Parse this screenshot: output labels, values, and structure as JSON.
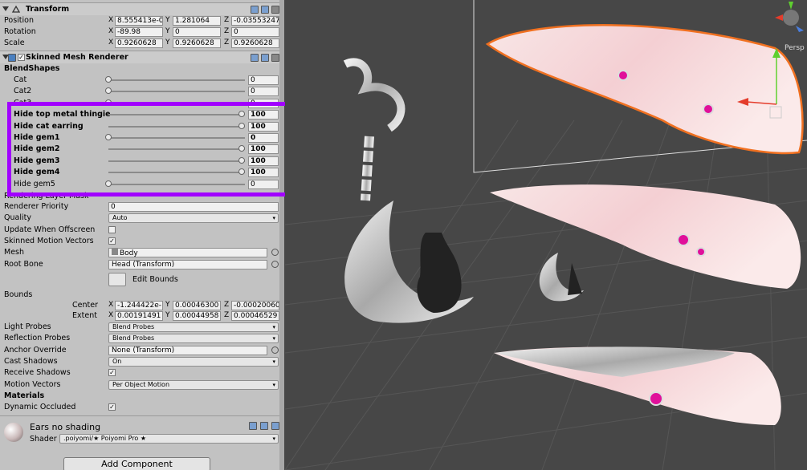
{
  "transform": {
    "title": "Transform",
    "position": {
      "label": "Position",
      "x": "8.555413e-0",
      "y": "1.281064",
      "z": "-0.03553247"
    },
    "rotation": {
      "label": "Rotation",
      "x": "-89.98",
      "y": "0",
      "z": "0"
    },
    "scale": {
      "label": "Scale",
      "x": "0.9260628",
      "y": "0.9260628",
      "z": "0.9260628"
    },
    "axis_x": "X",
    "axis_y": "Y",
    "axis_z": "Z"
  },
  "smr": {
    "title": "Skinned Mesh Renderer",
    "blendshapes_label": "BlendShapes",
    "blendshapes": [
      {
        "name": "Cat",
        "value": "0",
        "fraction": 0,
        "bold": false
      },
      {
        "name": "Cat2",
        "value": "0",
        "fraction": 0,
        "bold": false
      },
      {
        "name": "Cat3",
        "value": "0",
        "fraction": 0,
        "bold": false
      },
      {
        "name": "Hide top metal thingie",
        "value": "100",
        "fraction": 1,
        "bold": true
      },
      {
        "name": "Hide cat earring",
        "value": "100",
        "fraction": 1,
        "bold": true
      },
      {
        "name": "Hide gem1",
        "value": "0",
        "fraction": 0,
        "bold": true
      },
      {
        "name": "Hide gem2",
        "value": "100",
        "fraction": 1,
        "bold": true
      },
      {
        "name": "Hide gem3",
        "value": "100",
        "fraction": 1,
        "bold": true
      },
      {
        "name": "Hide gem4",
        "value": "100",
        "fraction": 1,
        "bold": true
      },
      {
        "name": "Hide gem5",
        "value": "0",
        "fraction": 0,
        "bold": false
      }
    ],
    "rendering_layer_mask_label": "Rendering Layer Mask",
    "renderer_priority": {
      "label": "Renderer Priority",
      "value": "0"
    },
    "quality": {
      "label": "Quality",
      "value": "Auto"
    },
    "update_offscreen": {
      "label": "Update When Offscreen",
      "checked": false
    },
    "skinned_motion": {
      "label": "Skinned Motion Vectors",
      "checked": true
    },
    "mesh": {
      "label": "Mesh",
      "value": "Body"
    },
    "root_bone": {
      "label": "Root Bone",
      "value": "Head (Transform)"
    },
    "edit_bounds": "Edit Bounds",
    "bounds_label": "Bounds",
    "center": {
      "label": "Center",
      "x": "-1.244422e-",
      "y": "0.00046300",
      "z": "-0.00020060"
    },
    "extent": {
      "label": "Extent",
      "x": "0.00191491",
      "y": "0.00044958",
      "z": "0.00046529"
    },
    "light_probes": {
      "label": "Light Probes",
      "value": "Blend Probes"
    },
    "reflection_probes": {
      "label": "Reflection Probes",
      "value": "Blend Probes"
    },
    "anchor_override": {
      "label": "Anchor Override",
      "value": "None (Transform)"
    },
    "cast_shadows": {
      "label": "Cast Shadows",
      "value": "On"
    },
    "receive_shadows": {
      "label": "Receive Shadows",
      "checked": true
    },
    "motion_vectors": {
      "label": "Motion Vectors",
      "value": "Per Object Motion"
    },
    "materials_label": "Materials",
    "dynamic_occluded": {
      "label": "Dynamic Occluded",
      "checked": true
    }
  },
  "material": {
    "name": "Ears no shading",
    "shader_label": "Shader",
    "shader_value": ".poiyomi/★ Poiyomi Pro ★"
  },
  "add_component": "Add Component",
  "scene": {
    "persp_label": "Persp",
    "check_glyph": "✓",
    "arrow_glyph": "▾"
  },
  "colors": {
    "highlight": "#a100ff",
    "selection": "#f07020",
    "gem": "#e0109a"
  }
}
